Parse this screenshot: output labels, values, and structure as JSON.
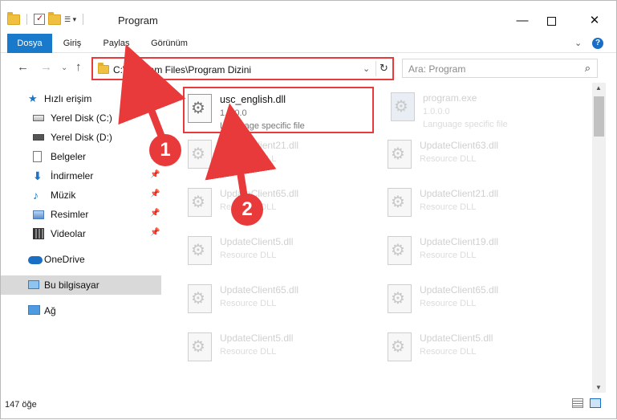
{
  "window": {
    "title": "Program"
  },
  "ribbon": {
    "tabs": [
      "Dosya",
      "Giriş",
      "Paylaş",
      "Görünüm"
    ]
  },
  "nav": {
    "address": "C:\\Program Files\\Program Dizini",
    "search_placeholder": "Ara: Program"
  },
  "sidebar": {
    "items": [
      {
        "label": "Hızlı erişim",
        "icon": "star-icon"
      },
      {
        "label": "Yerel Disk (C:)",
        "icon": "drive-icon"
      },
      {
        "label": "Yerel Disk (D:)",
        "icon": "drive-icon"
      },
      {
        "label": "Belgeler",
        "icon": "documents-icon"
      },
      {
        "label": "İndirmeler",
        "icon": "downloads-icon"
      },
      {
        "label": "Müzik",
        "icon": "music-icon"
      },
      {
        "label": "Resimler",
        "icon": "pictures-icon"
      },
      {
        "label": "Videolar",
        "icon": "videos-icon"
      },
      {
        "label": "OneDrive",
        "icon": "onedrive-icon"
      },
      {
        "label": "Bu bilgisayar",
        "icon": "computer-icon"
      },
      {
        "label": "Ağ",
        "icon": "network-icon"
      }
    ]
  },
  "files": [
    {
      "name": "usc_english.dll",
      "version": "1.0.0.0",
      "description": "Language specific file"
    },
    {
      "name": "program.exe",
      "version": "1.0.0.0",
      "description": "Language specific file"
    },
    {
      "name": "UpdateClient21.dll",
      "description": "Resource DLL"
    },
    {
      "name": "UpdateClient63.dll",
      "description": "Resource DLL"
    },
    {
      "name": "UpdateClient65.dll",
      "description": "Resource DLL"
    },
    {
      "name": "UpdateClient21.dll",
      "description": "Resource DLL"
    },
    {
      "name": "UpdateClient5.dll",
      "description": "Resource DLL"
    },
    {
      "name": "UpdateClient19.dll",
      "description": "Resource DLL"
    },
    {
      "name": "UpdateClient65.dll",
      "description": "Resource DLL"
    },
    {
      "name": "UpdateClient65.dll",
      "description": "Resource DLL"
    },
    {
      "name": "UpdateClient5.dll",
      "description": "Resource DLL"
    },
    {
      "name": "UpdateClient5.dll",
      "description": "Resource DLL"
    }
  ],
  "status": {
    "count": "147 öğe"
  },
  "annotations": {
    "step1": "1",
    "step2": "2",
    "color": "#e8393b"
  },
  "colors": {
    "accent": "#1979ca",
    "highlight": "#e8393b"
  }
}
